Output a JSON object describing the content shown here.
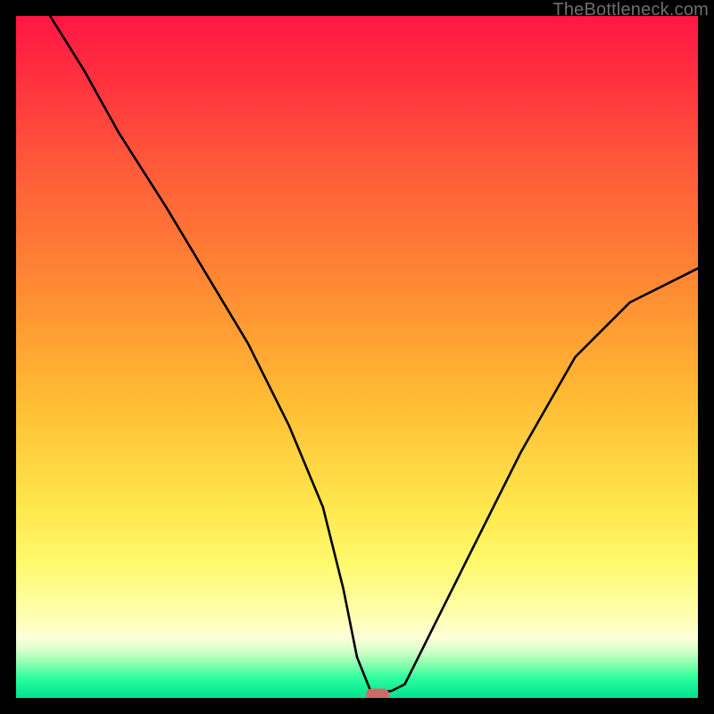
{
  "watermark": "TheBottleneck.com",
  "chart_data": {
    "type": "line",
    "title": "",
    "xlabel": "",
    "ylabel": "",
    "xlim": [
      0,
      100
    ],
    "ylim": [
      0,
      100
    ],
    "series": [
      {
        "name": "bottleneck-curve",
        "x": [
          5,
          10,
          15,
          22,
          28,
          34,
          40,
          45,
          48,
          50,
          52,
          54,
          55,
          57,
          59,
          66,
          74,
          82,
          90,
          98,
          100
        ],
        "values": [
          100,
          92,
          83,
          72,
          62,
          52,
          40,
          28,
          16,
          6,
          1,
          1,
          1,
          2,
          6,
          20,
          36,
          50,
          58,
          62,
          63
        ]
      }
    ],
    "marker": {
      "x": 53,
      "y": 0.5,
      "color": "#d06a6a"
    },
    "background_gradient": {
      "stops": [
        {
          "pos": 0,
          "color": "#ff1744"
        },
        {
          "pos": 22,
          "color": "#ff5a3a"
        },
        {
          "pos": 56,
          "color": "#ffbb33"
        },
        {
          "pos": 80,
          "color": "#fff96b"
        },
        {
          "pos": 93,
          "color": "#d9ffc9"
        },
        {
          "pos": 100,
          "color": "#00e28e"
        }
      ]
    }
  }
}
